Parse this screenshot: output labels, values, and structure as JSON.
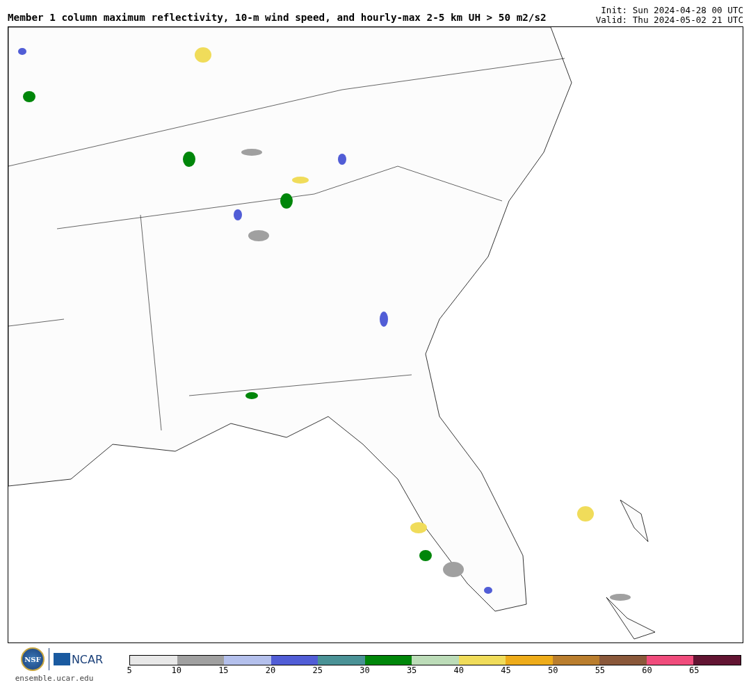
{
  "title": "Member 1 column maximum reflectivity, 10-m wind speed, and hourly-max 2-5 km UH > 50 m2/s2",
  "init": "Init: Sun 2024-04-28 00 UTC",
  "valid": "Valid: Thu 2024-05-02 21 UTC",
  "logos": {
    "nsf": "NSF",
    "ncar": "NCAR",
    "site": "ensemble.ucar.edu"
  },
  "colorbar": [
    {
      "color": "#e8e8e8",
      "label": "5"
    },
    {
      "color": "#a0a0a0",
      "label": "10"
    },
    {
      "color": "#b4c0ec",
      "label": "15"
    },
    {
      "color": "#515dd6",
      "label": "20"
    },
    {
      "color": "#4a9296",
      "label": "25"
    },
    {
      "color": "#00860a",
      "label": "30"
    },
    {
      "color": "#bcdcb8",
      "label": "35"
    },
    {
      "color": "#f0dc5a",
      "label": "40"
    },
    {
      "color": "#eeac1a",
      "label": "45"
    },
    {
      "color": "#ba7e2e",
      "label": "50"
    },
    {
      "color": "#8a583a",
      "label": "55"
    },
    {
      "color": "#f04c7c",
      "label": "60"
    },
    {
      "color": "#621432",
      "label": "65"
    }
  ]
}
